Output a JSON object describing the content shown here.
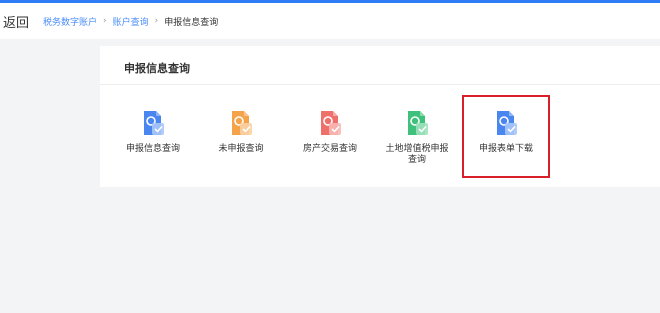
{
  "header": {
    "back_label": "返回",
    "breadcrumb": [
      {
        "label": "税务数字账户"
      },
      {
        "label": "账户查询"
      },
      {
        "label": "申报信息查询"
      }
    ],
    "separator": "›"
  },
  "card": {
    "title": "申报信息查询",
    "tiles": [
      {
        "label": "申报信息查询",
        "icon": "document-search-icon",
        "color": "#4a86f0"
      },
      {
        "label": "未申报查询",
        "icon": "document-pending-icon",
        "color": "#f5a34a"
      },
      {
        "label": "房产交易查询",
        "icon": "document-house-icon",
        "color": "#ef6f6a"
      },
      {
        "label": "土地增值税申报查询",
        "icon": "document-land-icon",
        "color": "#3fc17c"
      },
      {
        "label": "申报表单下载",
        "icon": "document-download-icon",
        "color": "#4a86f0"
      }
    ]
  },
  "accent_color": "#2f7cf6",
  "highlight_color": "#d9202a"
}
